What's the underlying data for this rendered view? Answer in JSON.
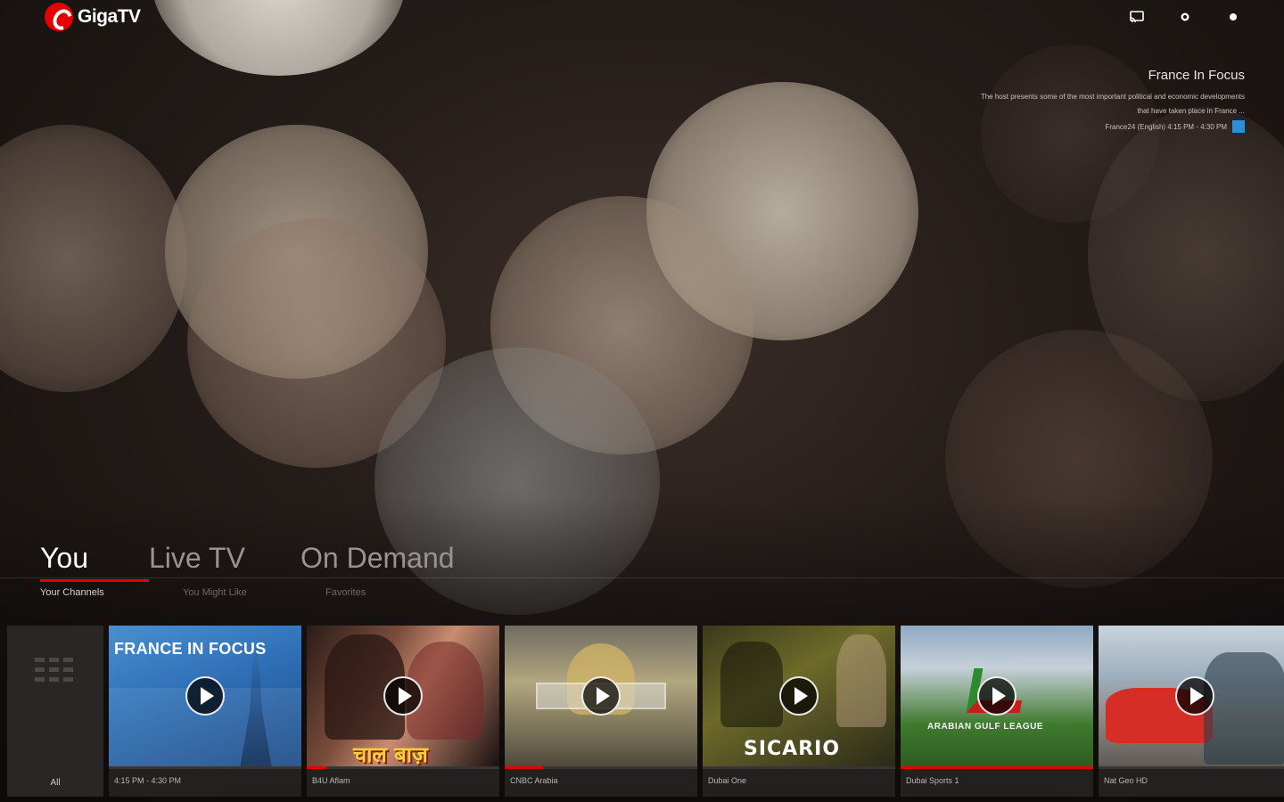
{
  "app": {
    "name": "GigaTV"
  },
  "icons": {
    "logo": "vodafone-logo-icon",
    "cast": "cast-icon",
    "settings": "settings-icon",
    "profile": "profile-dot-icon",
    "play": "play-icon",
    "grid": "grid-icon"
  },
  "colors": {
    "accent": "#e60000",
    "badge": "#2b8fd9"
  },
  "now_playing": {
    "title": "France In Focus",
    "description": "The host presents some of the most important political and economic developments that have taken place in France ...",
    "meta": "France24 (English) 4:15 PM - 4:30 PM"
  },
  "tabs": [
    {
      "label": "You",
      "active": true
    },
    {
      "label": "Live TV",
      "active": false
    },
    {
      "label": "On Demand",
      "active": false
    }
  ],
  "subtabs": [
    {
      "label": "Your Channels",
      "active": true
    },
    {
      "label": "You Might Like",
      "active": false
    },
    {
      "label": "Favorites",
      "active": false
    }
  ],
  "rail": {
    "all_label": "All",
    "cards": [
      {
        "label": "4:15 PM - 4:30 PM",
        "thumb_text": "FRANCE IN FOCUS",
        "progress": 0.0
      },
      {
        "label": "B4U Aflam",
        "thumb_text": "चाल बाज़",
        "progress": 0.1
      },
      {
        "label": "CNBC Arabia",
        "thumb_text": "",
        "progress": 0.2
      },
      {
        "label": "Dubai One",
        "thumb_text": "SICARIO",
        "progress": 0.0
      },
      {
        "label": "Dubai Sports 1",
        "thumb_text": "ARABIAN GULF LEAGUE",
        "progress": 1.0
      },
      {
        "label": "Nat Geo HD",
        "thumb_text": "",
        "progress": 0.0
      }
    ]
  }
}
